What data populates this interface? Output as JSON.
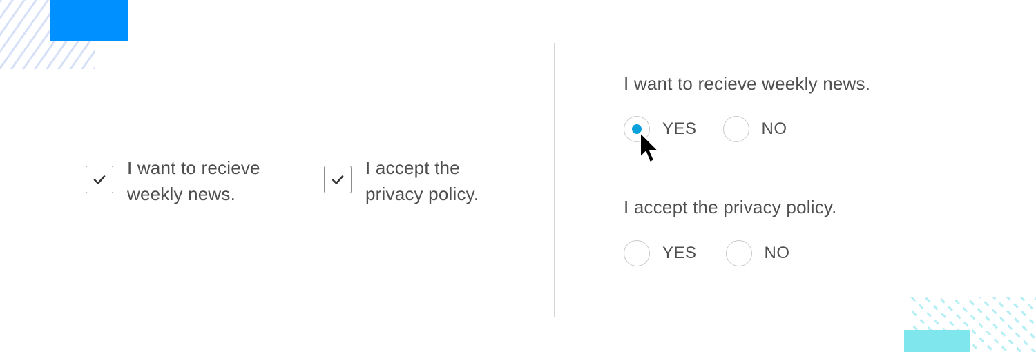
{
  "colors": {
    "accent_blue": "#0090ff",
    "accent_cyan": "#7fe6ee",
    "radio_selected": "#0aa0dc",
    "checkmark": "#333333"
  },
  "checkboxes": [
    {
      "line1": "I want to recieve",
      "line2": "weekly news.",
      "checked": true,
      "icon": "checkmark-icon"
    },
    {
      "line1": "I accept the",
      "line2": "privacy policy.",
      "checked": true,
      "icon": "checkmark-icon"
    }
  ],
  "radio_groups": [
    {
      "question": "I want to recieve weekly news.",
      "options": [
        {
          "label": "YES",
          "selected": true
        },
        {
          "label": "NO",
          "selected": false
        }
      ]
    },
    {
      "question": "I accept the privacy policy.",
      "options": [
        {
          "label": "YES",
          "selected": false
        },
        {
          "label": "NO",
          "selected": false
        }
      ]
    }
  ],
  "cursor": {
    "icon": "mouse-pointer-icon"
  }
}
